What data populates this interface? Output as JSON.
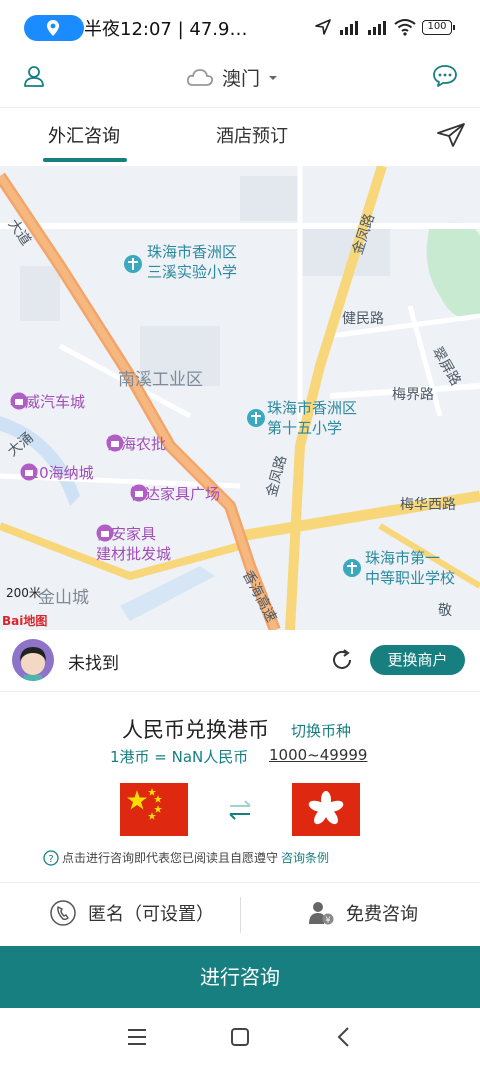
{
  "status_bar": {
    "text": "半夜12:07 | 47.9…",
    "battery": "100",
    "signal_labels": [
      "HD",
      "HD"
    ]
  },
  "header": {
    "city": "澳门"
  },
  "tabs": [
    {
      "label": "外汇咨询",
      "active": true
    },
    {
      "label": "酒店预订",
      "active": false
    }
  ],
  "map": {
    "pois": [
      {
        "type": "school",
        "lines": [
          "珠海市香洲区",
          "三溪实验小学"
        ]
      },
      {
        "type": "school",
        "lines": [
          "珠海市香洲区",
          "第十五小学"
        ]
      },
      {
        "type": "school",
        "lines": [
          "珠海市第一",
          "中等职业学校"
        ]
      },
      {
        "type": "shop",
        "lines": [
          "华威汽车城"
        ]
      },
      {
        "type": "shop",
        "lines": [
          "铭海农批"
        ]
      },
      {
        "type": "shop",
        "lines": [
          "020海纳城"
        ]
      },
      {
        "type": "shop",
        "lines": [
          "智达家具广场"
        ]
      },
      {
        "type": "shop",
        "lines": [
          "日安家具",
          "建材批发城"
        ]
      }
    ],
    "areas": [
      "南溪工业区",
      "金山城"
    ],
    "roads": [
      "金凤路",
      "健民路",
      "梅界路",
      "金凤路",
      "梅华西路",
      "香海高速",
      "大道",
      "大涌",
      "翠屏路",
      "敬"
    ],
    "scale": "200米",
    "attribution": "Bai地图"
  },
  "merchant": {
    "name": "未找到",
    "change_label": "更换商户"
  },
  "exchange": {
    "title": "人民币兑换港币",
    "switch_label": "切换币种",
    "rate": "1港币 = NaN人民币",
    "range": "1000~49999",
    "notice_prefix": "点击进行咨询即代表您已阅读且自愿遵守",
    "notice_link": "咨询条例"
  },
  "options": {
    "anonymous": "匿名（可设置）",
    "free": "免费咨询"
  },
  "submit_label": "进行咨询",
  "colors": {
    "accent": "#177f80",
    "flag_red": "#de2910",
    "star_yellow": "#ffde00"
  }
}
